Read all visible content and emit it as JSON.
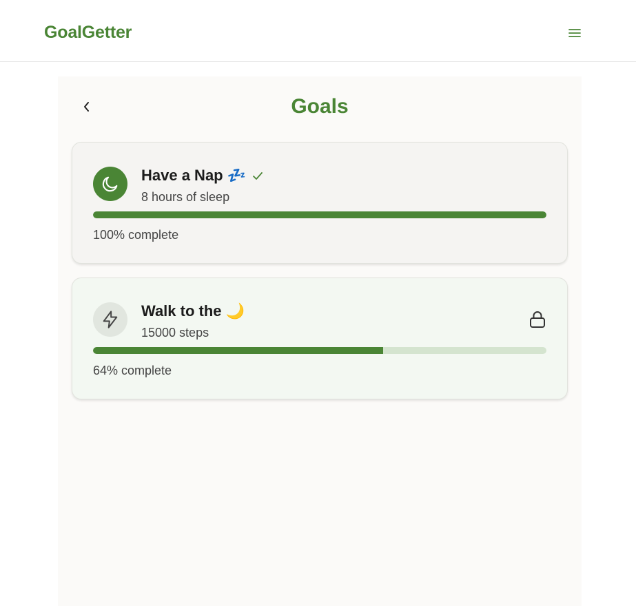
{
  "app": {
    "brand": "GoalGetter",
    "menu_icon": "hamburger-menu-icon",
    "accent_color": "#4a8535"
  },
  "page": {
    "title": "Goals",
    "back_icon": "chevron-left-icon"
  },
  "goals": [
    {
      "title": "Have a Nap 💤",
      "subtitle": "8 hours of sleep",
      "icon": "moon-icon",
      "status": "completed",
      "status_icon": "check-icon",
      "progress_percent": 100,
      "progress_label": "100% complete"
    },
    {
      "title": "Walk to the 🌙",
      "subtitle": "15000 steps",
      "icon": "lightning-icon",
      "status": "locked",
      "status_icon": "lock-icon",
      "progress_percent": 64,
      "progress_label": "64% complete"
    }
  ]
}
